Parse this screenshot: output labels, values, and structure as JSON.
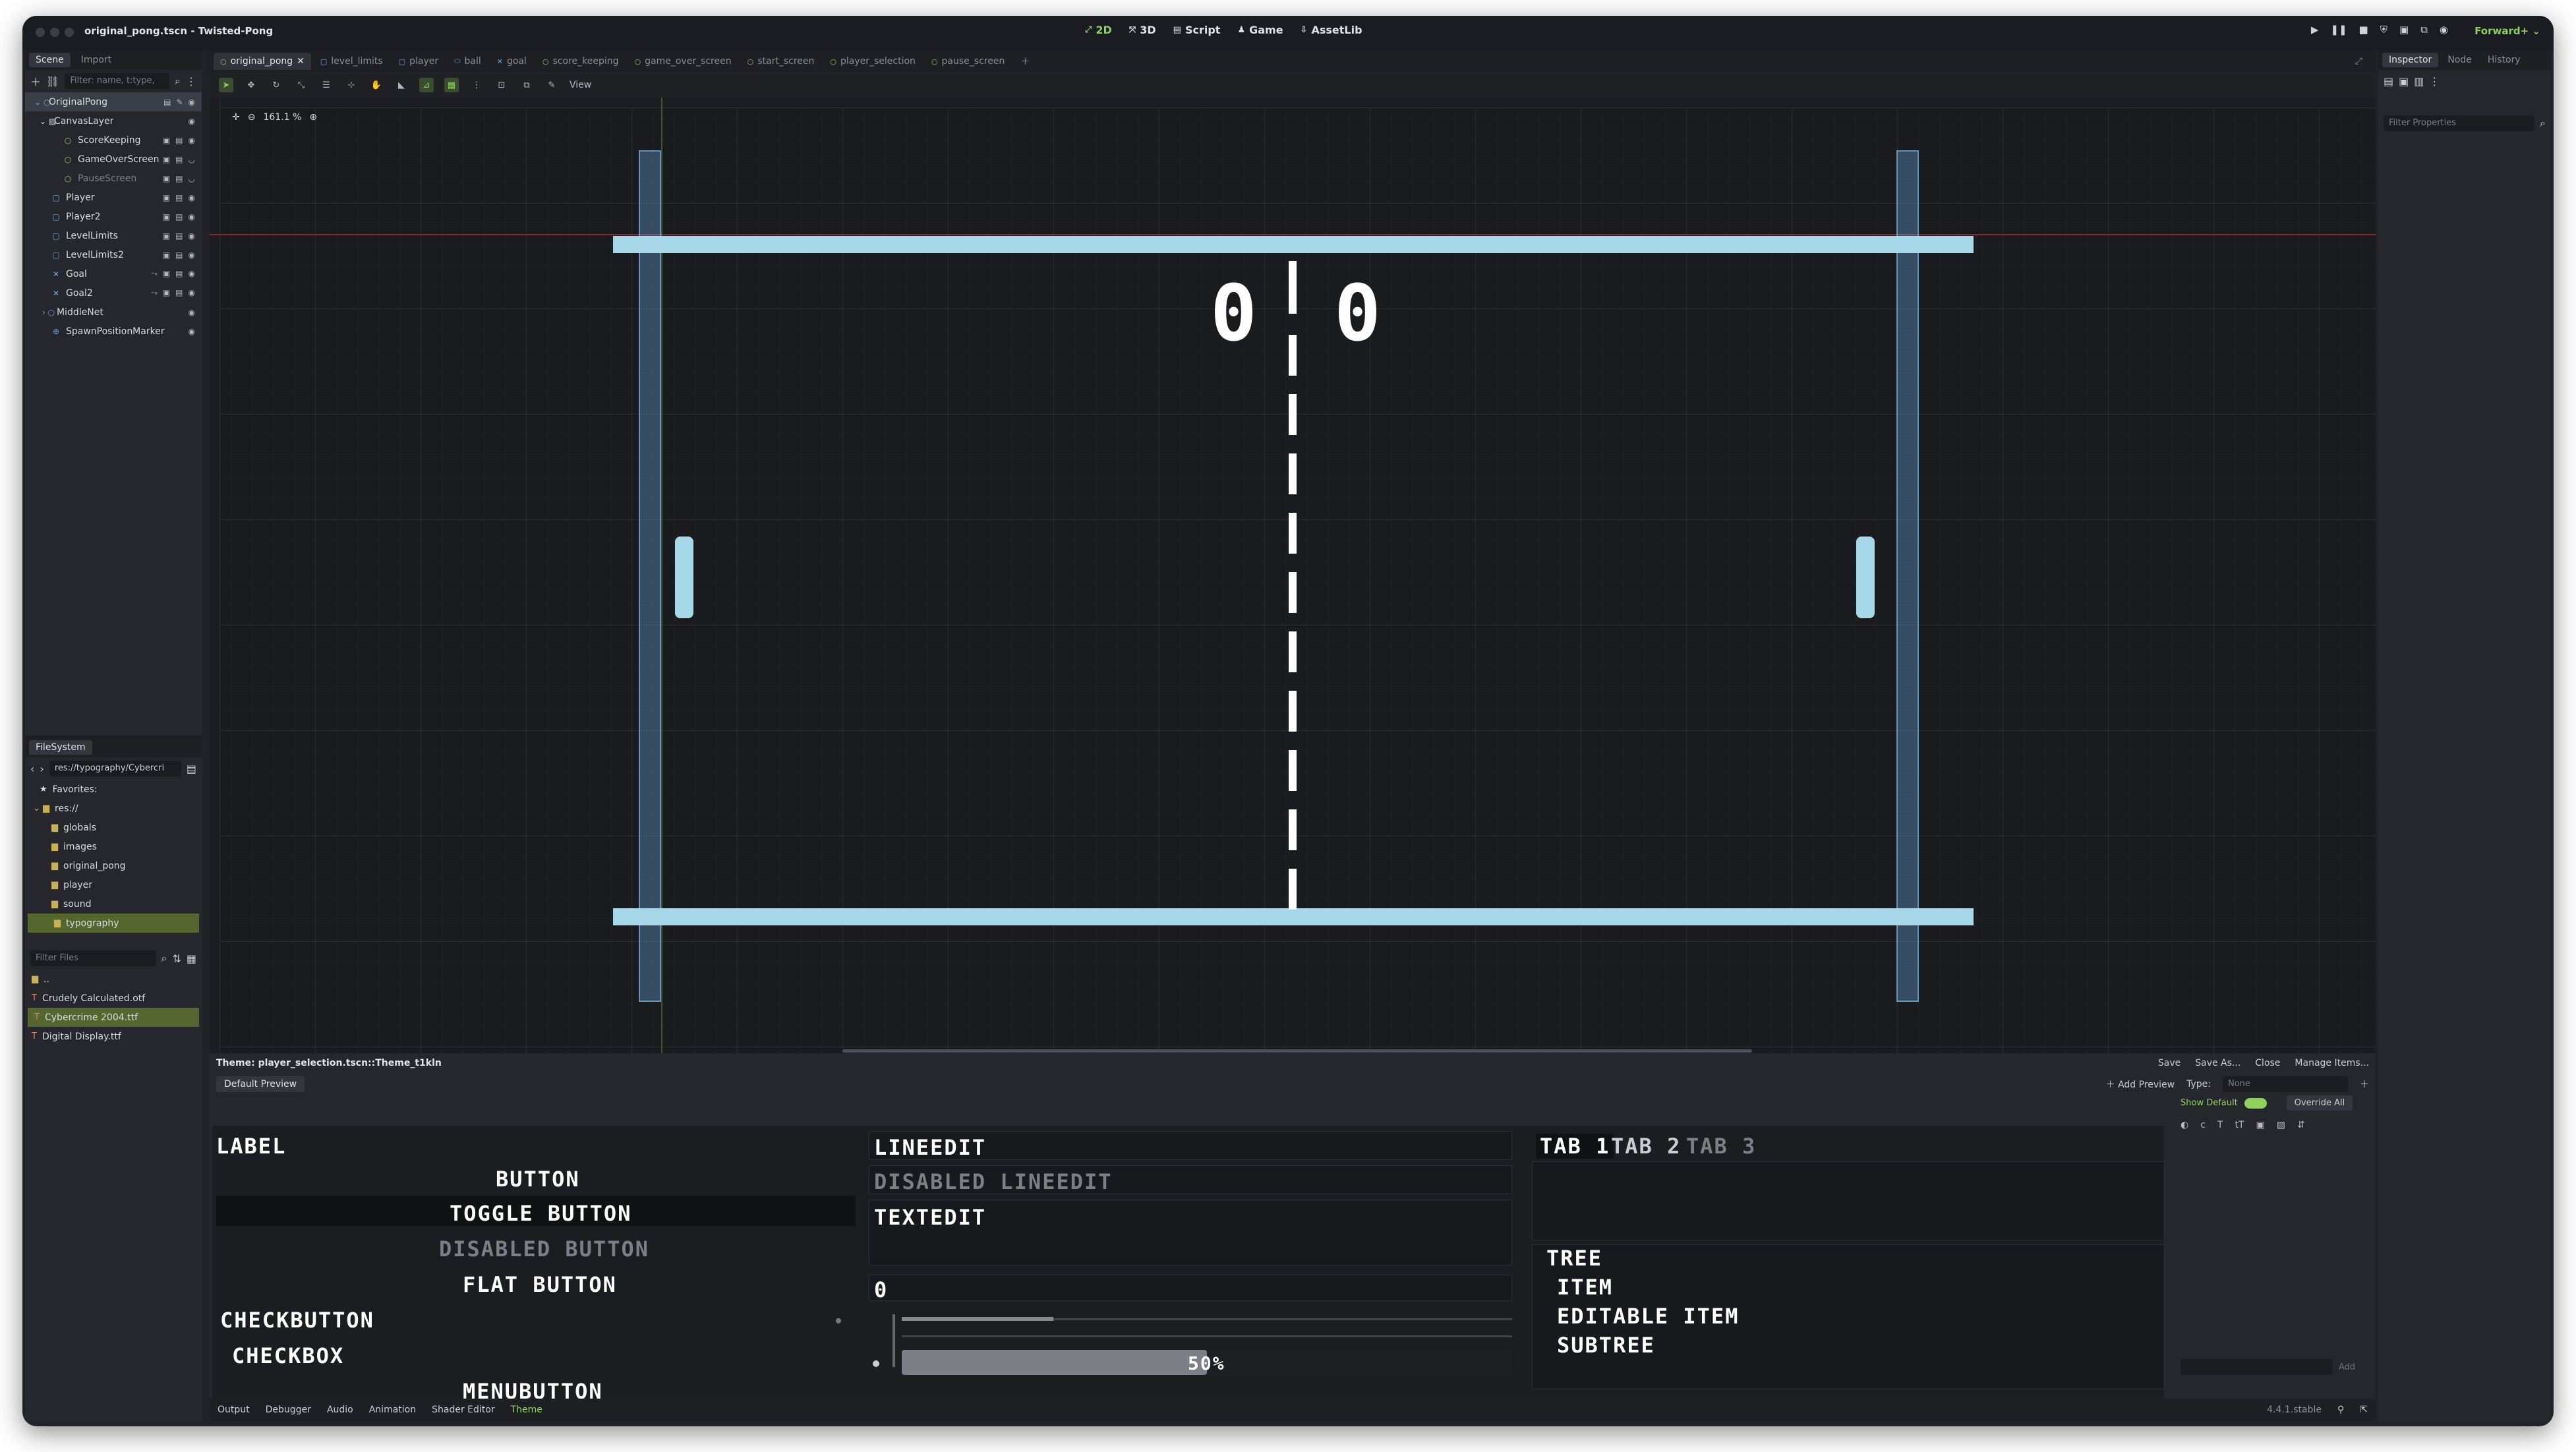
{
  "window": {
    "title": "original_pong.tscn - Twisted-Pong"
  },
  "modes": [
    {
      "icon": "2d-icon",
      "label": "2D",
      "active": true
    },
    {
      "icon": "3d-icon",
      "label": "3D"
    },
    {
      "icon": "script-icon",
      "label": "Script"
    },
    {
      "icon": "game-icon",
      "label": "Game"
    },
    {
      "icon": "assetlib-icon",
      "label": "AssetLib"
    }
  ],
  "renderer": "Forward+",
  "scene_dock": {
    "tabs": [
      "Scene",
      "Import"
    ],
    "filter_placeholder": "Filter: name, t:type,",
    "nodes": [
      {
        "label": "OriginalPong",
        "icon": "node2d-icon",
        "level": 0
      },
      {
        "label": "CanvasLayer",
        "icon": "canvaslayer-icon",
        "level": 1
      },
      {
        "label": "ScoreKeeping",
        "icon": "control-icon",
        "level": 2
      },
      {
        "label": "GameOverScreen",
        "icon": "control-icon",
        "level": 2
      },
      {
        "label": "PauseScreen",
        "icon": "control-icon",
        "level": 2,
        "dim": true
      },
      {
        "label": "Player",
        "icon": "body-icon",
        "level": 1
      },
      {
        "label": "Player2",
        "icon": "body-icon",
        "level": 1
      },
      {
        "label": "LevelLimits",
        "icon": "body-icon",
        "level": 1
      },
      {
        "label": "LevelLimits2",
        "icon": "body-icon",
        "level": 1
      },
      {
        "label": "Goal",
        "icon": "area-icon",
        "level": 1
      },
      {
        "label": "Goal2",
        "icon": "area-icon",
        "level": 1
      },
      {
        "label": "MiddleNet",
        "icon": "node2d-icon",
        "level": 1
      },
      {
        "label": "SpawnPositionMarker",
        "icon": "marker-icon",
        "level": 1
      }
    ]
  },
  "filesystem": {
    "tab": "FileSystem",
    "path": "res://typography/Cybercri",
    "favorites": "Favorites:",
    "root": "res://",
    "folders": [
      "globals",
      "images",
      "original_pong",
      "player",
      "sound",
      "typography"
    ],
    "filter_placeholder": "Filter Files",
    "files": [
      "..",
      "Crudely Calculated.otf",
      "Cybercrime 2004.ttf",
      "Digital Display.ttf"
    ]
  },
  "scene_tabs": [
    "original_pong",
    "level_limits",
    "player",
    "ball",
    "goal",
    "score_keeping",
    "game_over_screen",
    "start_screen",
    "player_selection",
    "pause_screen"
  ],
  "viewport": {
    "zoom": "161.1 %",
    "view_menu": "View",
    "score_left": "0",
    "score_right": "0"
  },
  "inspector": {
    "tabs": [
      "Inspector",
      "Node",
      "History"
    ],
    "filter_placeholder": "Filter Properties"
  },
  "theme_editor": {
    "title": "Theme: player_selection.tscn::Theme_t1kln",
    "actions": [
      "Save",
      "Save As...",
      "Close",
      "Manage Items..."
    ],
    "preview_tab": "Default Preview",
    "add_preview": "Add Preview",
    "type_label": "Type:",
    "type_value": "None",
    "show_default": "Show Default",
    "override_all": "Override All",
    "add_button": "Add",
    "preview": {
      "label": "LABEL",
      "button": "BUTTON",
      "toggle_button": "TOGGLE BUTTON",
      "disabled_button": "DISABLED BUTTON",
      "flat_button": "FLAT BUTTON",
      "checkbutton": "CHECKBUTTON",
      "checkbox": "CHECKBOX",
      "menubutton": "MENUBUTTON",
      "lineedit": "LINEEDIT",
      "disabled_lineedit": "DISABLED LINEEDIT",
      "textedit": "TEXTEDIT",
      "spinbox_value": "0",
      "progress": "50%",
      "tabs": [
        "TAB 1",
        "TAB 2",
        "TAB 3"
      ],
      "tree": [
        "TREE",
        "ITEM",
        "EDITABLE ITEM",
        "SUBTREE"
      ]
    }
  },
  "bottom_tabs": [
    "Output",
    "Debugger",
    "Audio",
    "Animation",
    "Shader Editor",
    "Theme"
  ],
  "version": "4.4.1.stable",
  "colors": {
    "accent": "#8ed15f",
    "paddle": "#a6d8ea",
    "limit": "#6aa9e6",
    "selection_folder": "#55662e"
  }
}
